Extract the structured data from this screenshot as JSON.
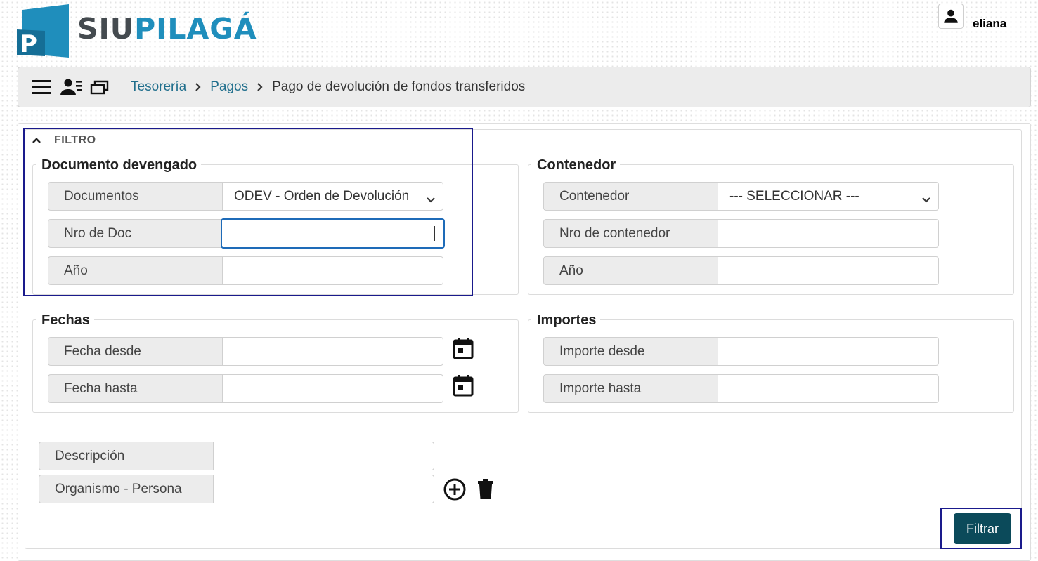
{
  "brand": {
    "part1": "SIU",
    "part2": "PILAGÁ",
    "mark_letter": "P",
    "color_dark": "#444a4f",
    "color_blue": "#1f8ebc"
  },
  "user": {
    "name": "eliana",
    "icon": "user-icon"
  },
  "topbar": {
    "icons": [
      "menu-icon",
      "contacts-icon",
      "windows-icon"
    ],
    "breadcrumb": {
      "item1": "Tesorería",
      "item2": "Pagos",
      "current": "Pago de devolución de fondos transferidos"
    }
  },
  "filter": {
    "title": "FILTRO",
    "documento": {
      "legend": "Documento devengado",
      "documentos_label": "Documentos",
      "documentos_value": "ODEV - Orden de Devolución",
      "nro_label": "Nro de Doc",
      "nro_value": "",
      "anio_label": "Año",
      "anio_value": ""
    },
    "contenedor": {
      "legend": "Contenedor",
      "contenedor_label": "Contenedor",
      "contenedor_value": "--- SELECCIONAR ---",
      "nro_label": "Nro de contenedor",
      "nro_value": "",
      "anio_label": "Año",
      "anio_value": ""
    },
    "fechas": {
      "legend": "Fechas",
      "desde_label": "Fecha desde",
      "desde_value": "",
      "hasta_label": "Fecha hasta",
      "hasta_value": ""
    },
    "importes": {
      "legend": "Importes",
      "desde_label": "Importe desde",
      "desde_value": "",
      "hasta_label": "Importe hasta",
      "hasta_value": ""
    },
    "descripcion_label": "Descripción",
    "descripcion_value": "",
    "organismo_label": "Organismo - Persona",
    "organismo_value": "",
    "filtrar_button": {
      "accel": "F",
      "rest": "iltrar",
      "color": "#0b4a5a"
    },
    "highlight_color": "#1a1a8c"
  }
}
